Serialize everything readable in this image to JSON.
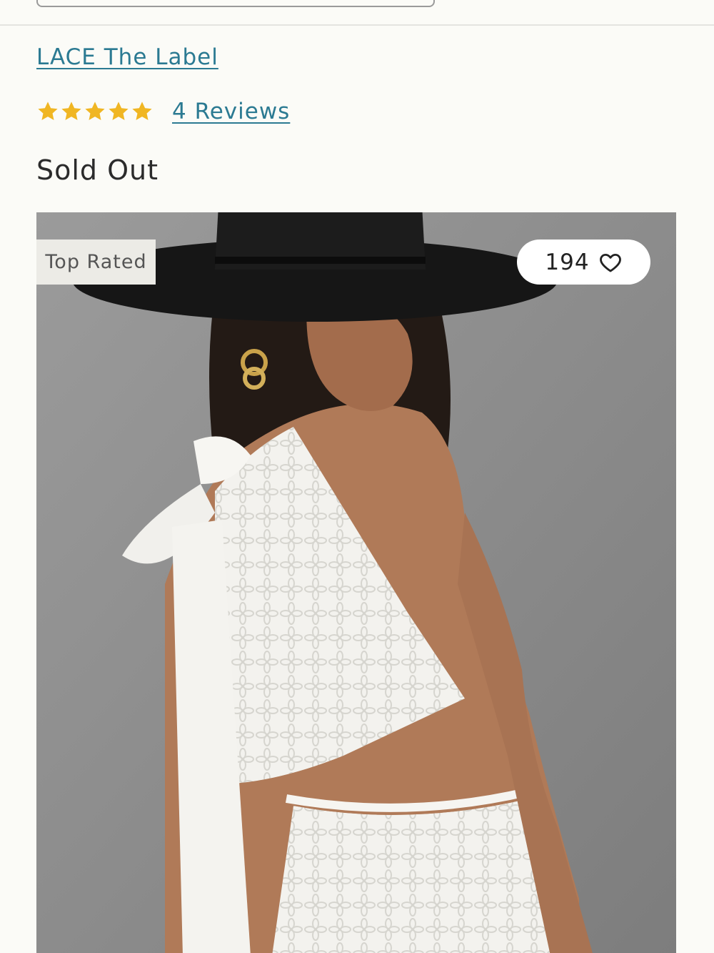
{
  "header": {
    "search_value": ""
  },
  "product": {
    "brand": "LACE The Label",
    "rating": {
      "stars": 5,
      "max_stars": 5,
      "reviews_label": "4 Reviews",
      "star_color": "#f0b623"
    },
    "availability": "Sold Out",
    "image": {
      "badge": "Top Rated",
      "favorites_count": "194",
      "heart_icon": "heart-outline-icon"
    }
  },
  "colors": {
    "link": "#2b7a92",
    "text": "#2b2b2b",
    "background": "#fbfbf7"
  }
}
